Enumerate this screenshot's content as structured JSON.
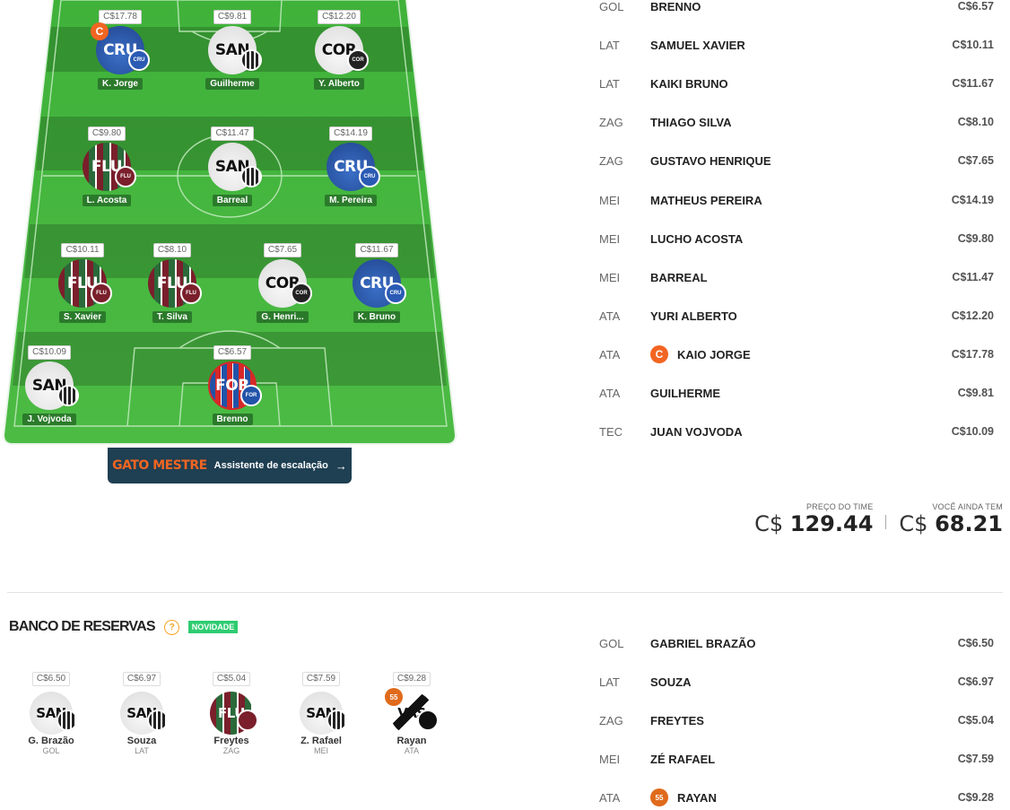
{
  "field": {
    "players": [
      {
        "name": "K. Jorge",
        "price": "C$17.78",
        "team": "CRU",
        "kit": "blue",
        "badge_color": "#2a5ab4",
        "badge_text": "CRU",
        "captain": true
      },
      {
        "name": "Guilherme",
        "price": "C$9.81",
        "team": "SAN",
        "kit": "white",
        "badge_color": "#222222",
        "badge_text": "",
        "captain": false
      },
      {
        "name": "Y. Alberto",
        "price": "C$12.20",
        "team": "COR",
        "kit": "white",
        "badge_color": "#222222",
        "badge_text": "COR",
        "captain": false
      },
      {
        "name": "L. Acosta",
        "price": "C$9.80",
        "team": "FLU",
        "kit": "flu",
        "badge_color": "#7a1f2b",
        "badge_text": "FLU",
        "captain": false
      },
      {
        "name": "Barreal",
        "price": "C$11.47",
        "team": "SAN",
        "kit": "white",
        "badge_color": "#222222",
        "badge_text": "",
        "captain": false
      },
      {
        "name": "M. Pereira",
        "price": "C$14.19",
        "team": "CRU",
        "kit": "blue",
        "badge_color": "#2a5ab4",
        "badge_text": "CRU",
        "captain": false
      },
      {
        "name": "S. Xavier",
        "price": "C$10.11",
        "team": "FLU",
        "kit": "flu",
        "badge_color": "#7a1f2b",
        "badge_text": "FLU",
        "captain": false
      },
      {
        "name": "T. Silva",
        "price": "C$8.10",
        "team": "FLU",
        "kit": "flu",
        "badge_color": "#7a1f2b",
        "badge_text": "FLU",
        "captain": false
      },
      {
        "name": "G. Henri...",
        "price": "C$7.65",
        "team": "COR",
        "kit": "white",
        "badge_color": "#222222",
        "badge_text": "COR",
        "captain": false
      },
      {
        "name": "K. Bruno",
        "price": "C$11.67",
        "team": "CRU",
        "kit": "blue",
        "badge_color": "#2a5ab4",
        "badge_text": "CRU",
        "captain": false
      },
      {
        "name": "J. Vojvoda",
        "price": "C$10.09",
        "team": "SAN",
        "kit": "white",
        "badge_color": "#222222",
        "badge_text": "",
        "captain": false
      },
      {
        "name": "Brenno",
        "price": "C$6.57",
        "team": "FOR",
        "kit": "for",
        "badge_color": "#2153a8",
        "badge_text": "FOR",
        "captain": false
      }
    ],
    "captain_letter": "C"
  },
  "gato": {
    "brand": "GATO MESTRE",
    "label": "Assistente de escalação",
    "arrow": "→"
  },
  "lineup": [
    {
      "pos": "GOL",
      "name": "BRENNO",
      "price": "C$6.57",
      "icon": ""
    },
    {
      "pos": "LAT",
      "name": "SAMUEL XAVIER",
      "price": "C$10.11",
      "icon": ""
    },
    {
      "pos": "LAT",
      "name": "KAIKI BRUNO",
      "price": "C$11.67",
      "icon": ""
    },
    {
      "pos": "ZAG",
      "name": "THIAGO SILVA",
      "price": "C$8.10",
      "icon": ""
    },
    {
      "pos": "ZAG",
      "name": "GUSTAVO HENRIQUE",
      "price": "C$7.65",
      "icon": ""
    },
    {
      "pos": "MEI",
      "name": "MATHEUS PEREIRA",
      "price": "C$14.19",
      "icon": ""
    },
    {
      "pos": "MEI",
      "name": "LUCHO ACOSTA",
      "price": "C$9.80",
      "icon": ""
    },
    {
      "pos": "MEI",
      "name": "BARREAL",
      "price": "C$11.47",
      "icon": ""
    },
    {
      "pos": "ATA",
      "name": "YURI ALBERTO",
      "price": "C$12.20",
      "icon": ""
    },
    {
      "pos": "ATA",
      "name": "KAIO JORGE",
      "price": "C$17.78",
      "icon": "C"
    },
    {
      "pos": "ATA",
      "name": "GUILHERME",
      "price": "C$9.81",
      "icon": ""
    },
    {
      "pos": "TEC",
      "name": "JUAN VOJVODA",
      "price": "C$10.09",
      "icon": ""
    }
  ],
  "summary": {
    "team_price_label": "PREÇO DO TIME",
    "team_price_currency": "C$",
    "team_price_value": "129.44",
    "remaining_label": "VOCÊ AINDA TEM",
    "remaining_currency": "C$",
    "remaining_value": "68.21"
  },
  "bench": {
    "title": "BANCO DE RESERVAS",
    "help": "?",
    "new_badge": "NOVIDADE",
    "players": [
      {
        "name": "G. Brazão",
        "pos": "GOL",
        "price": "C$6.50",
        "team": "SAN",
        "kit": "white"
      },
      {
        "name": "Souza",
        "pos": "LAT",
        "price": "C$6.97",
        "team": "SAN",
        "kit": "white"
      },
      {
        "name": "Freytes",
        "pos": "ZAG",
        "price": "C$5.04",
        "team": "FLU",
        "kit": "flu"
      },
      {
        "name": "Z. Rafael",
        "pos": "MEI",
        "price": "C$7.59",
        "team": "SAN",
        "kit": "white"
      },
      {
        "name": "Rayan",
        "pos": "ATA",
        "price": "C$9.28",
        "team": "VAS",
        "kit": "vas"
      }
    ],
    "list": [
      {
        "pos": "GOL",
        "name": "GABRIEL BRAZÃO",
        "price": "C$6.50",
        "icon": ""
      },
      {
        "pos": "LAT",
        "name": "SOUZA",
        "price": "C$6.97",
        "icon": ""
      },
      {
        "pos": "ZAG",
        "name": "FREYTES",
        "price": "C$5.04",
        "icon": ""
      },
      {
        "pos": "MEI",
        "name": "ZÉ RAFAEL",
        "price": "C$7.59",
        "icon": ""
      },
      {
        "pos": "ATA",
        "name": "RAYAN",
        "price": "C$9.28",
        "icon": "55"
      }
    ]
  },
  "colors": {
    "field_green": "#43b53a",
    "accent_orange": "#f26522",
    "new_green": "#2ecc71",
    "gato_bg": "#1f3f52"
  }
}
